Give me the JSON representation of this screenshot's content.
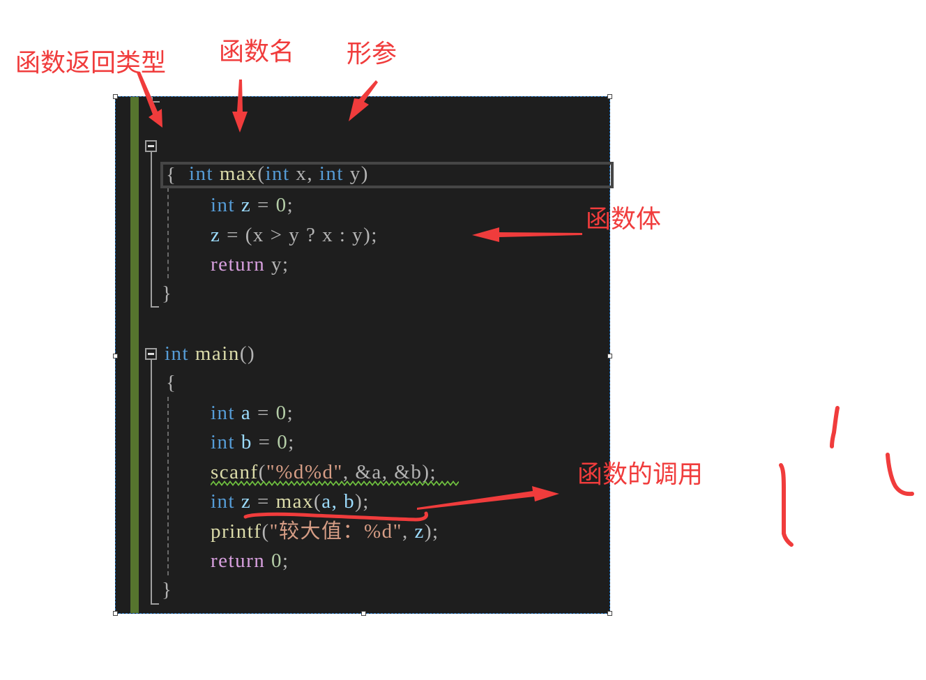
{
  "annotations": {
    "return_type": "函数返回类型",
    "function_name": "函数名",
    "parameters": "形参",
    "function_body": "函数体",
    "function_call": "函数的调用"
  },
  "colors": {
    "annotation": "#f03c3c",
    "editor_bg": "#1e1e1e",
    "keyword": "#569cd6",
    "function": "#dcdcaa",
    "variable": "#9cdcfe",
    "number": "#b5cea8",
    "control": "#d8a0df",
    "string": "#d69d85",
    "change_bar": "#56752e"
  },
  "code": {
    "max_sig": {
      "kw1": "int",
      "name": "max",
      "open": "(",
      "kw2": "int",
      "p1": " x, ",
      "kw3": "int",
      "p2": " y",
      "close": ")"
    },
    "max_open_brace": "{",
    "max_l1": {
      "kw": "int",
      "var": "z",
      "op": " = ",
      "num": "0",
      "end": ";"
    },
    "max_l2": {
      "var": "z",
      "rest": " = (x > y ? x : y);"
    },
    "max_l3": {
      "ctl": "return",
      "rest": " y;"
    },
    "max_close_brace": "}",
    "main_sig": {
      "kw": "int",
      "name": "main",
      "parens": "()"
    },
    "main_open_brace": "{",
    "main_l1": {
      "kw": "int",
      "var": "a",
      "op": " = ",
      "num": "0",
      "end": ";"
    },
    "main_l2": {
      "kw": "int",
      "var": "b",
      "op": " = ",
      "num": "0",
      "end": ";"
    },
    "main_l3": {
      "fn": "scanf",
      "open": "(",
      "str": "\"%d%d\"",
      "rest": ", &a, &b)",
      "end": ";"
    },
    "main_l4": {
      "kw": "int",
      "var": "z",
      "op": " = ",
      "fn": "max",
      "open": "(",
      "args": "a, b",
      "close": ")",
      "end": ";"
    },
    "main_l5": {
      "fn": "printf",
      "open": "(",
      "str": "\"较大值：%d\"",
      "rest": ", ",
      "var": "z",
      "close": ")",
      "end": ";"
    },
    "main_l6": {
      "ctl": "return",
      "sp": " ",
      "num": "0",
      "end": ";"
    },
    "main_close_brace": "}"
  }
}
